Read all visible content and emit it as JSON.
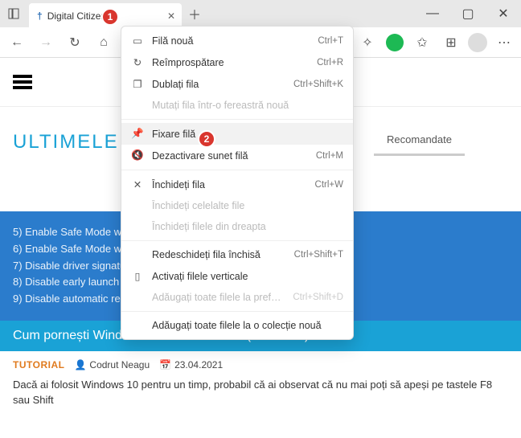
{
  "tab": {
    "title": "Digital Citizen"
  },
  "nav": {
    "recommended": "Recomandate"
  },
  "section": {
    "title": "ULTIMELE ART"
  },
  "safemode_list": [
    "5) Enable Safe Mode with Networking",
    "6) Enable Safe Mode with Command Prompt",
    "7) Disable driver signature enforcement",
    "8) Disable early launch anti-malware protection",
    "9) Disable automatic restart after failure"
  ],
  "article": {
    "title": "Cum pornești Windows 10 în Safe Mode (9 metode)",
    "tag": "TUTORIAL",
    "author": "Codrut Neagu",
    "date": "23.04.2021",
    "excerpt": "Dacă ai folosit Windows 10 pentru un timp, probabil că ai observat că nu mai poți să apeși pe tastele F8 sau Shift"
  },
  "context_menu": [
    {
      "icon": "▭",
      "label": "Filă nouă",
      "shortcut": "Ctrl+T",
      "state": ""
    },
    {
      "icon": "↻",
      "label": "Reîmprospătare",
      "shortcut": "Ctrl+R",
      "state": ""
    },
    {
      "icon": "❐",
      "label": "Dublați fila",
      "shortcut": "Ctrl+Shift+K",
      "state": ""
    },
    {
      "icon": "",
      "label": "Mutați fila într-o fereastră nouă",
      "shortcut": "",
      "state": "disabled"
    },
    {
      "sep": true
    },
    {
      "icon": "📌",
      "label": "Fixare filă",
      "shortcut": "",
      "state": "hover"
    },
    {
      "icon": "🔇",
      "label": "Dezactivare sunet filă",
      "shortcut": "Ctrl+M",
      "state": ""
    },
    {
      "sep": true
    },
    {
      "icon": "✕",
      "label": "Închideți fila",
      "shortcut": "Ctrl+W",
      "state": ""
    },
    {
      "icon": "",
      "label": "Închideți celelalte file",
      "shortcut": "",
      "state": "disabled"
    },
    {
      "icon": "",
      "label": "Închideți filele din dreapta",
      "shortcut": "",
      "state": "disabled"
    },
    {
      "sep": true
    },
    {
      "icon": "",
      "label": "Redeschideți fila închisă",
      "shortcut": "Ctrl+Shift+T",
      "state": ""
    },
    {
      "icon": "▯",
      "label": "Activați filele verticale",
      "shortcut": "",
      "state": ""
    },
    {
      "icon": "",
      "label": "Adăugați toate filele la preferințe",
      "shortcut": "Ctrl+Shift+D",
      "state": "disabled"
    },
    {
      "sep": true
    },
    {
      "icon": "",
      "label": "Adăugați toate filele la o colecție nouă",
      "shortcut": "",
      "state": ""
    }
  ],
  "badges": {
    "one": "1",
    "two": "2"
  }
}
